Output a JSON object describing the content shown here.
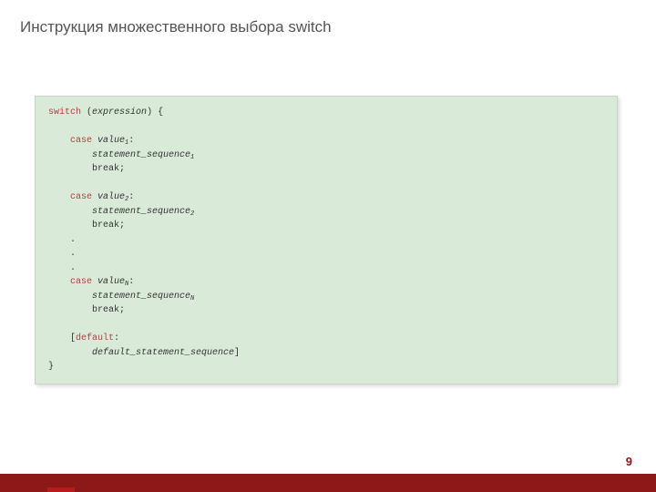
{
  "title": "Инструкция множественного выбора switch",
  "page_number": "9",
  "code": {
    "kw_switch": "switch",
    "kw_case": "case",
    "kw_break": "break;",
    "kw_default": "default",
    "lp": "(",
    "rp": ") {",
    "close": "}",
    "expr": "expression",
    "value": "value",
    "stmt": "statement_sequence",
    "colon": ":",
    "dot": ".",
    "lbr": "[",
    "rbr": "]",
    "def_stmt": "default_statement_sequence",
    "sub1": "1",
    "sub2": "2",
    "subN": "N"
  }
}
